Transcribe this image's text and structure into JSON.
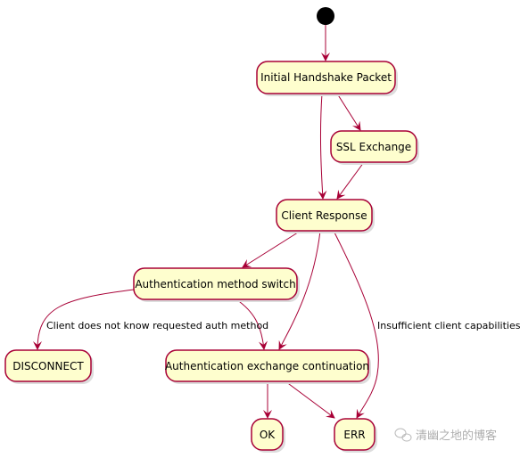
{
  "diagram": {
    "type": "activity",
    "colors": {
      "node_fill": "#FEFECE",
      "node_border": "#A80036",
      "edge": "#A80036",
      "start": "#000000"
    },
    "nodes": {
      "initial": "Initial Handshake Packet",
      "ssl": "SSL Exchange",
      "client_response": "Client Response",
      "auth_switch": "Authentication method switch",
      "disconnect": "DISCONNECT",
      "auth_continue": "Authentication exchange continuation",
      "ok": "OK",
      "err": "ERR"
    },
    "edge_labels": {
      "switch_to_disconnect": "Client does not know requested auth method",
      "response_to_err": "Insufficient client capabilities"
    },
    "edges": [
      [
        "start",
        "initial"
      ],
      [
        "initial",
        "ssl"
      ],
      [
        "initial",
        "client_response"
      ],
      [
        "ssl",
        "client_response"
      ],
      [
        "client_response",
        "auth_switch"
      ],
      [
        "client_response",
        "auth_continue"
      ],
      [
        "client_response",
        "err"
      ],
      [
        "auth_switch",
        "disconnect"
      ],
      [
        "auth_switch",
        "auth_continue"
      ],
      [
        "auth_continue",
        "ok"
      ],
      [
        "auth_continue",
        "err"
      ]
    ]
  },
  "watermark": {
    "text": "清幽之地的博客",
    "icon": "wechat-icon"
  }
}
